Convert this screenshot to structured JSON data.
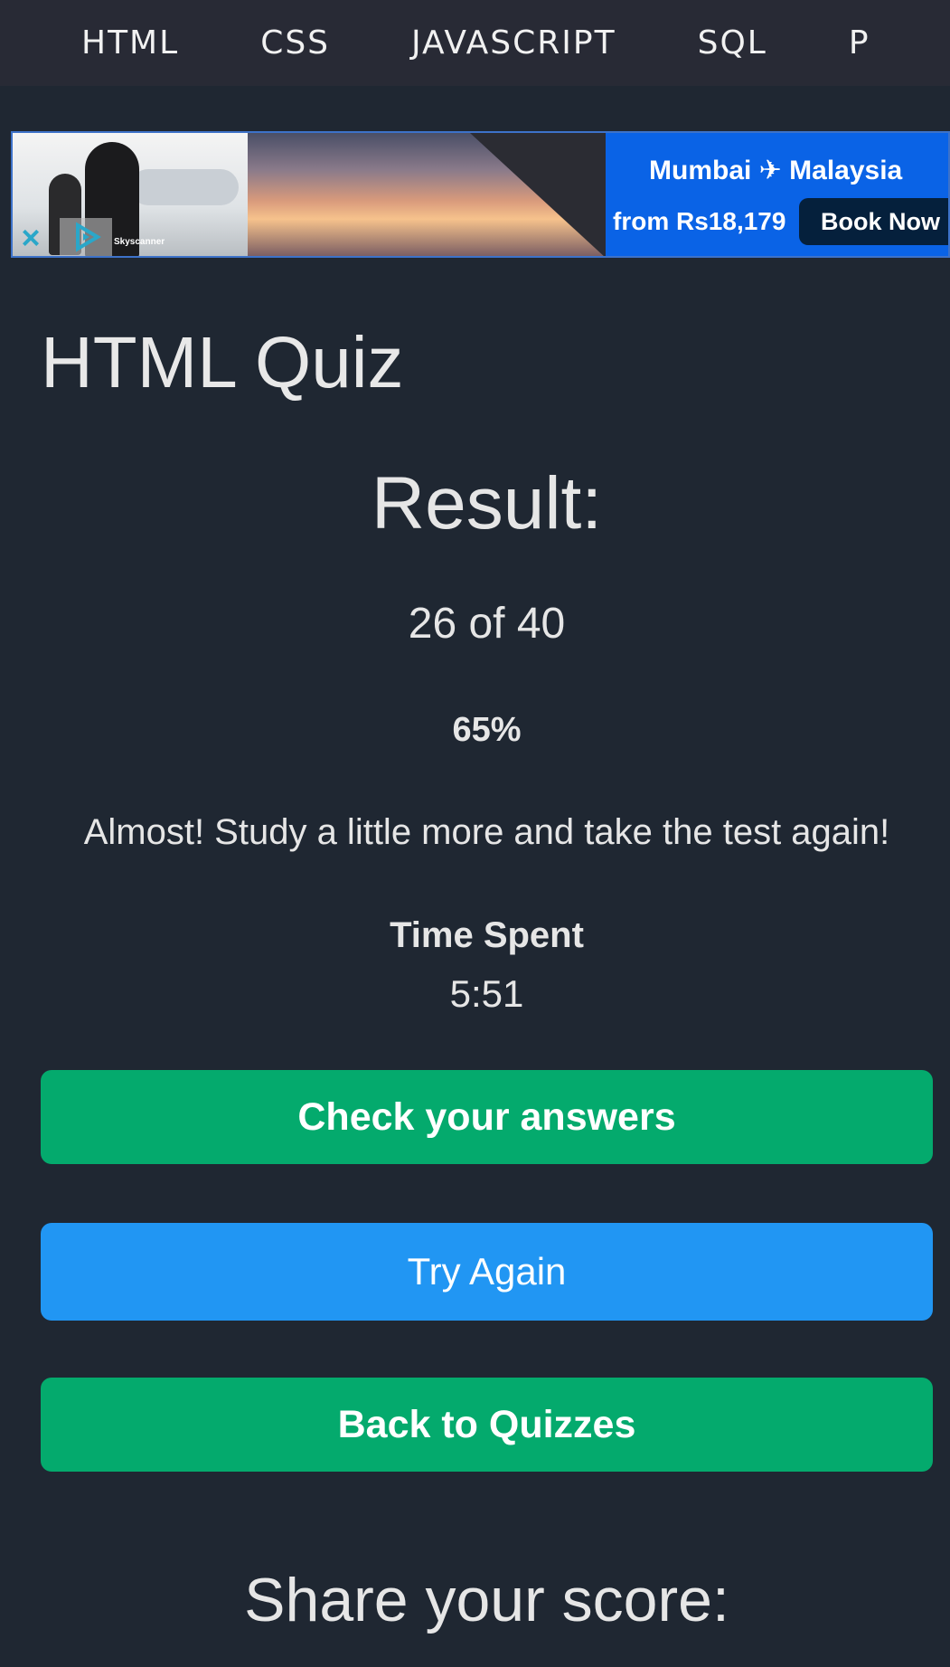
{
  "nav": {
    "menu_icon": "hamburger-icon",
    "links": [
      "HTML",
      "CSS",
      "JAVASCRIPT",
      "SQL",
      "P"
    ]
  },
  "ad": {
    "brand": "Skyscanner",
    "route": "Mumbai ✈ Malaysia",
    "price": "from Rs18,179",
    "cta": "Book Now",
    "close_glyph": "×"
  },
  "quiz": {
    "title": "HTML Quiz",
    "result_heading": "Result:",
    "score": "26 of 40",
    "percent": "65%",
    "message": "Almost! Study a little more and take the test again!",
    "time_label": "Time Spent",
    "time_value": "5:51"
  },
  "buttons": {
    "check": "Check your answers",
    "try_again": "Try Again",
    "back": "Back to Quizzes"
  },
  "share": {
    "heading": "Share your score:"
  },
  "colors": {
    "background": "#1f2732",
    "topbar": "#282a35",
    "green": "#04aa6d",
    "blue": "#2196f3",
    "ad_blue": "#0a63e6"
  }
}
